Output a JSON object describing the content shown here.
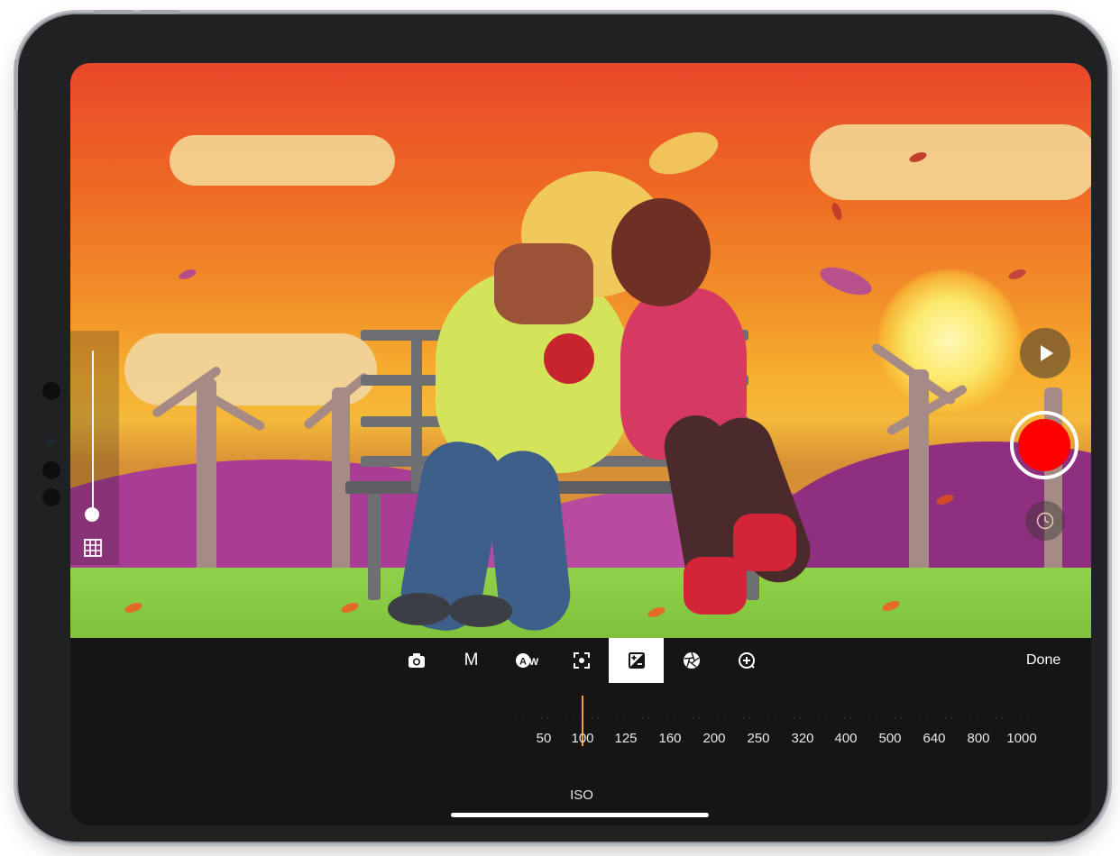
{
  "toolbar": {
    "items": [
      {
        "id": "photo",
        "icon": "camera-icon",
        "label": ""
      },
      {
        "id": "manual",
        "icon": "",
        "label": "M"
      },
      {
        "id": "white_balance",
        "icon": "auto-white-balance-icon",
        "label": ""
      },
      {
        "id": "focus",
        "icon": "focus-icon",
        "label": ""
      },
      {
        "id": "exposure",
        "icon": "exposure-icon",
        "label": "",
        "active": true
      },
      {
        "id": "aperture",
        "icon": "aperture-icon",
        "label": ""
      },
      {
        "id": "zoom",
        "icon": "zoom-in-icon",
        "label": ""
      }
    ],
    "done_label": "Done"
  },
  "iso": {
    "title": "ISO",
    "values": [
      "50",
      "100",
      "125",
      "160",
      "200",
      "250",
      "320",
      "400",
      "500",
      "640",
      "800",
      "1000"
    ],
    "selected": "100",
    "indicator_color": "#f0a030"
  },
  "right_controls": {
    "play_icon": "play-icon",
    "record_icon": "record-icon",
    "record_color": "#ff0000",
    "timer_icon": "clock-icon"
  },
  "left_controls": {
    "slider_icon": "vertical-slider",
    "grid_icon": "grid-icon"
  }
}
